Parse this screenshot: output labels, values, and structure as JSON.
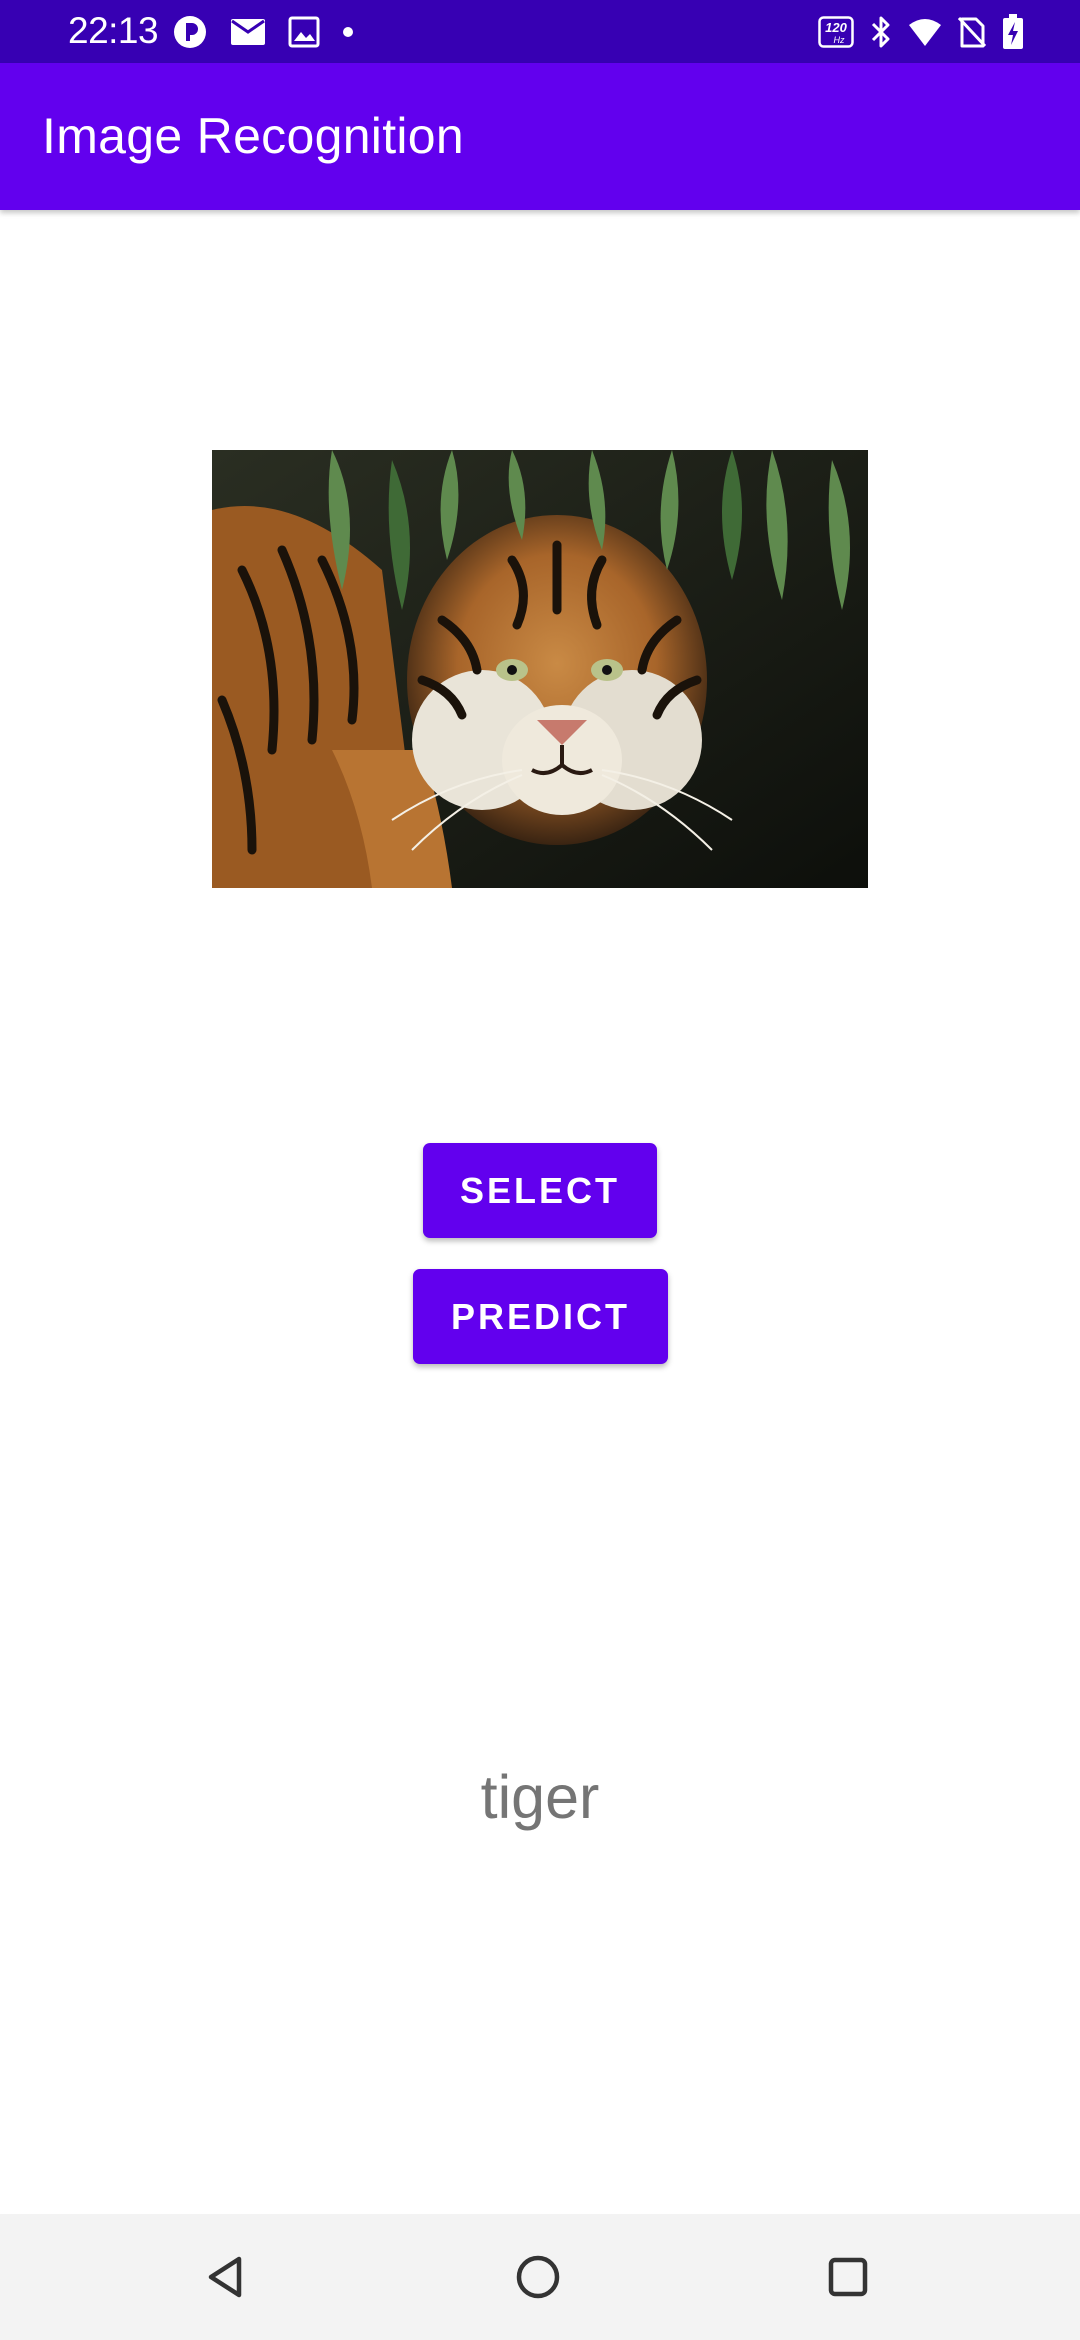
{
  "status_bar": {
    "time": "22:13",
    "left_icons": [
      "app-notification-icon",
      "mail-icon",
      "image-icon",
      "dot-icon"
    ],
    "right_icons": [
      "refresh-rate-120hz-icon",
      "bluetooth-icon",
      "wifi-icon",
      "no-sim-icon",
      "battery-charging-icon"
    ],
    "refresh_rate_label": "120",
    "refresh_rate_unit": "Hz"
  },
  "app_bar": {
    "title": "Image Recognition"
  },
  "image": {
    "subject": "tiger-photo"
  },
  "buttons": {
    "select_label": "SELECT",
    "predict_label": "PREDICT"
  },
  "result": {
    "label": "tiger"
  },
  "nav_bar": {
    "icons": [
      "back-icon",
      "home-icon",
      "recents-icon"
    ]
  },
  "colors": {
    "status_bar": "#3700b3",
    "primary": "#6200ee",
    "result_text": "#757575",
    "nav_background": "#f3f3f3"
  }
}
